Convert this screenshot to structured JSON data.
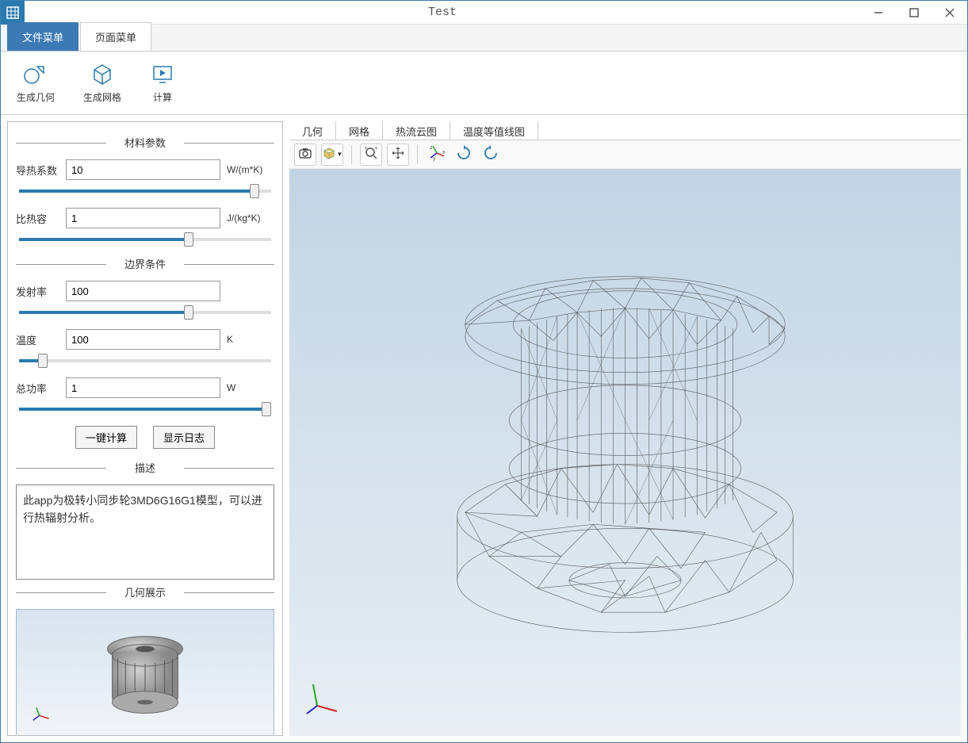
{
  "window": {
    "title": "Test"
  },
  "tabs": {
    "file_menu": "文件菜单",
    "page_menu": "页面菜单"
  },
  "ribbon": {
    "gen_geometry": "生成几何",
    "gen_mesh": "生成网格",
    "compute": "计算"
  },
  "sidebar": {
    "material_section": "材料参数",
    "boundary_section": "边界条件",
    "description_section": "描述",
    "geometry_section": "几何展示",
    "params": {
      "thermal_conductivity": {
        "label": "导热系数",
        "value": "10",
        "unit": "W/(m*K)"
      },
      "specific_heat": {
        "label": "比热容",
        "value": "1",
        "unit": "J/(kg*K)"
      },
      "emissivity": {
        "label": "发射率",
        "value": "100",
        "unit": ""
      },
      "temperature": {
        "label": "温度",
        "value": "100",
        "unit": "K"
      },
      "total_power": {
        "label": "总功率",
        "value": "1",
        "unit": "W"
      }
    },
    "buttons": {
      "one_click_compute": "一键计算",
      "show_log": "显示日志"
    },
    "description_text": "此app为极转小同步轮3MD6G16G1模型，可以进行热辐射分析。"
  },
  "viewport": {
    "tabs": {
      "geometry": "几何",
      "mesh": "网格",
      "heat_contour": "热流云图",
      "temp_isoline": "温度等值线图"
    }
  }
}
